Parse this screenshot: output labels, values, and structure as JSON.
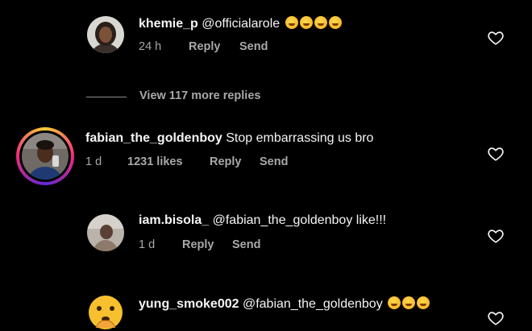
{
  "comments": [
    {
      "username": "khemie_p",
      "text": "@officialarole",
      "emoji_count": 4,
      "emoji": "rolling-on-floor-laughing",
      "time": "24 h",
      "likes": "",
      "reply_label": "Reply",
      "send_label": "Send"
    },
    {
      "username": "fabian_the_goldenboy",
      "text": "Stop embarrassing us bro",
      "emoji_count": 0,
      "time": "1 d",
      "likes": "1231 likes",
      "reply_label": "Reply",
      "send_label": "Send",
      "story_ring": true
    },
    {
      "username": "iam.bisola_",
      "text": "@fabian_the_goldenboy like!!!",
      "emoji_count": 0,
      "time": "1 d",
      "likes": "",
      "reply_label": "Reply",
      "send_label": "Send"
    },
    {
      "username": "yung_smoke002",
      "text": "@fabian_the_goldenboy",
      "emoji_count": 3,
      "emoji": "grinning-squinting-face",
      "time": "",
      "likes": "",
      "reply_label": "",
      "send_label": ""
    }
  ],
  "view_replies": "View 117 more replies",
  "colors": {
    "background": "#000000",
    "text_primary": "#f5f5f5",
    "text_secondary": "#a8a8a8",
    "emoji": "#f3a91b"
  },
  "icons": {
    "like": "heart-outline-icon"
  }
}
